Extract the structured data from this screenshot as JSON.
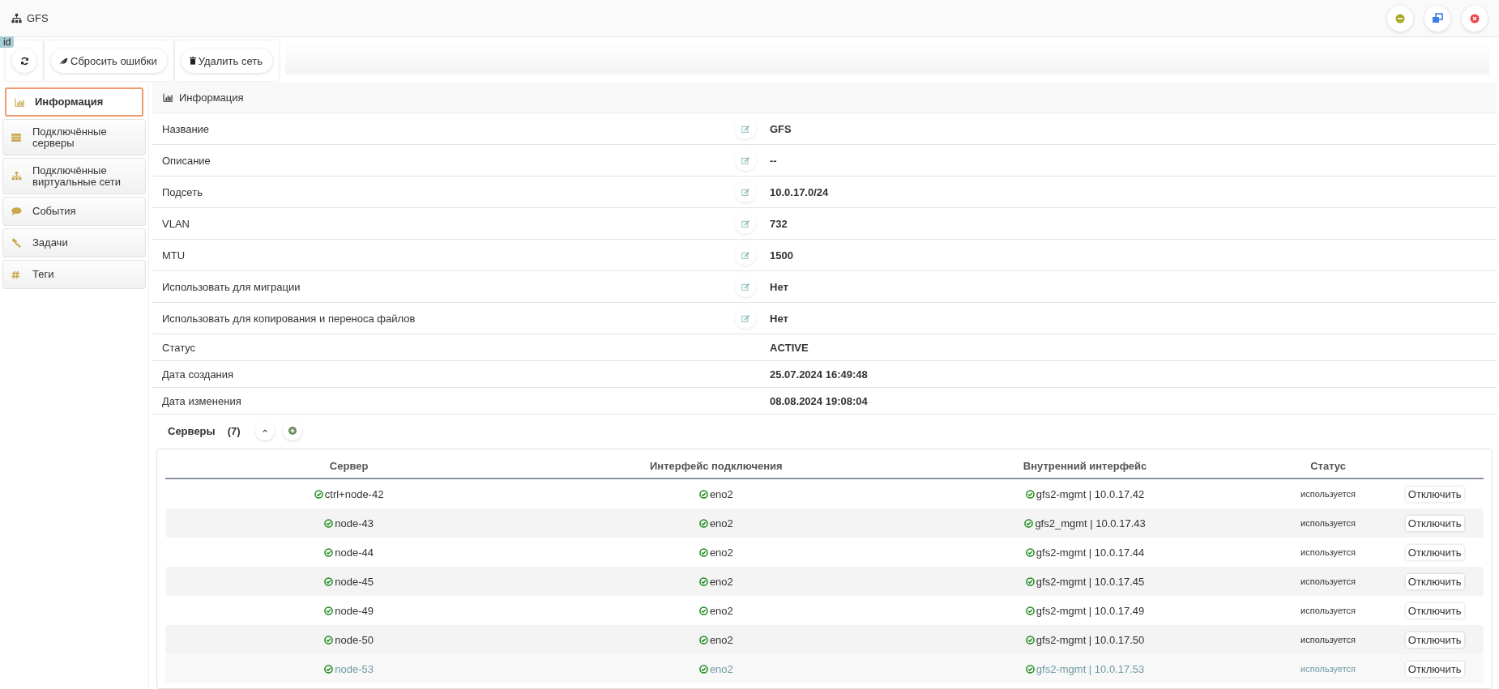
{
  "window": {
    "title": "GFS"
  },
  "id_badge": "id",
  "toolbar": [
    {
      "kind": "refresh"
    },
    {
      "kind": "reset",
      "label": "Сбросить ошибки"
    },
    {
      "kind": "delete",
      "label": "Удалить сеть"
    }
  ],
  "sidebar": {
    "items": [
      {
        "kind": "chart",
        "label": "Информация",
        "selected": true
      },
      {
        "kind": "servers",
        "label": "Подключённые серверы",
        "selected": false
      },
      {
        "kind": "network",
        "label": "Подключённые виртуальные сети",
        "selected": false
      },
      {
        "kind": "events",
        "label": "События",
        "selected": false
      },
      {
        "kind": "tasks",
        "label": "Задачи",
        "selected": false
      },
      {
        "kind": "tags",
        "label": "Теги",
        "selected": false
      }
    ]
  },
  "info": {
    "title": "Информация",
    "properties": [
      {
        "label": "Название",
        "value": "GFS",
        "editable": true
      },
      {
        "label": "Описание",
        "value": "--",
        "editable": true
      },
      {
        "label": "Подсеть",
        "value": "10.0.17.0/24",
        "editable": true
      },
      {
        "label": "VLAN",
        "value": "732",
        "editable": true
      },
      {
        "label": "MTU",
        "value": "1500",
        "editable": true
      },
      {
        "label": "Использовать для миграции",
        "value": "Нет",
        "editable": true
      },
      {
        "label": "Использовать для копирования и переноса файлов",
        "value": "Нет",
        "editable": true
      },
      {
        "label": "Статус",
        "value": "ACTIVE",
        "editable": false
      },
      {
        "label": "Дата создания",
        "value": "25.07.2024 16:49:48",
        "editable": false
      },
      {
        "label": "Дата изменения",
        "value": "08.08.2024 19:08:04",
        "editable": false
      }
    ]
  },
  "servers": {
    "title": "Серверы",
    "count": "(7)",
    "expanded": true,
    "table": {
      "columns": [
        "Сервер",
        "Интерфейс подключения",
        "Внутренний интерфейс",
        "Статус"
      ],
      "rows": [
        {
          "server": "ctrl+node-42",
          "interface": "eno2",
          "internal": "gfs2-mgmt | 10.0.17.42",
          "status": "используется",
          "action": "Отключить",
          "dimmed": false
        },
        {
          "server": "node-43",
          "interface": "eno2",
          "internal": "gfs2_mgmt | 10.0.17.43",
          "status": "используется",
          "action": "Отключить",
          "dimmed": false
        },
        {
          "server": "node-44",
          "interface": "eno2",
          "internal": "gfs2-mgmt | 10.0.17.44",
          "status": "используется",
          "action": "Отключить",
          "dimmed": false
        },
        {
          "server": "node-45",
          "interface": "eno2",
          "internal": "gfs2-mgmt | 10.0.17.45",
          "status": "используется",
          "action": "Отключить",
          "dimmed": false
        },
        {
          "server": "node-49",
          "interface": "eno2",
          "internal": "gfs2-mgmt | 10.0.17.49",
          "status": "используется",
          "action": "Отключить",
          "dimmed": false
        },
        {
          "server": "node-50",
          "interface": "eno2",
          "internal": "gfs2-mgmt | 10.0.17.50",
          "status": "используется",
          "action": "Отключить",
          "dimmed": false
        },
        {
          "server": "node-53",
          "interface": "eno2",
          "internal": "gfs2-mgmt | 10.0.17.53",
          "status": "используется",
          "action": "Отключить",
          "dimmed": true
        }
      ]
    }
  }
}
